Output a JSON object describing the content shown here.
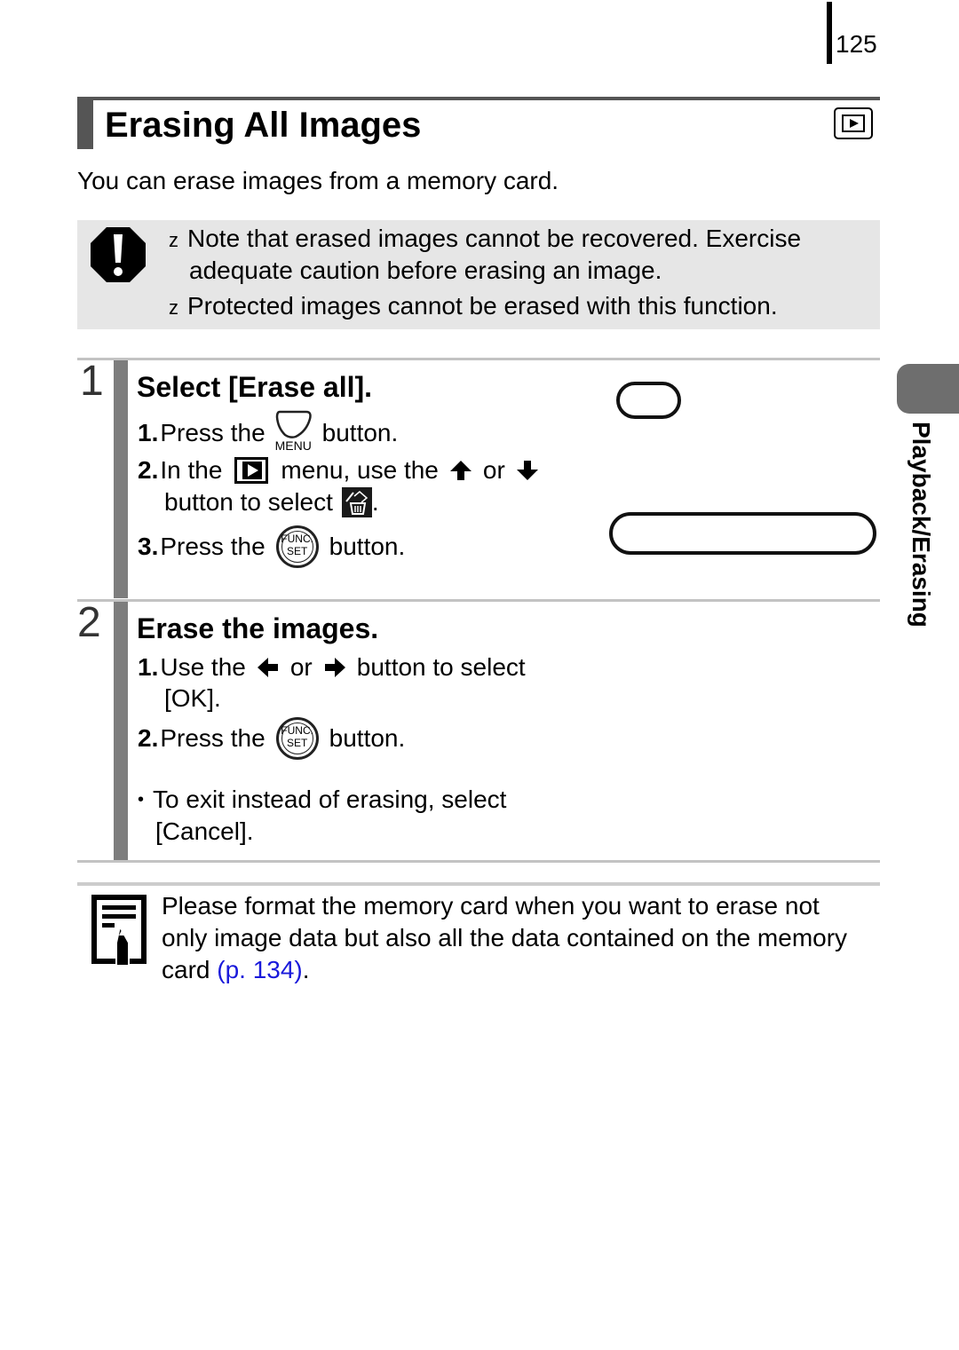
{
  "page": {
    "number": "125",
    "title": "Erasing All Images",
    "mode_icon": "playback-mode-icon",
    "intro": "You can erase images from a memory card."
  },
  "caution": {
    "icon": "caution-icon",
    "bullet_glyph": "z",
    "items": [
      {
        "lines": [
          "Note that erased images cannot be recovered. Exercise",
          "adequate caution before erasing an image."
        ]
      },
      {
        "lines": [
          "Protected images cannot be erased with this function."
        ]
      }
    ]
  },
  "steps": [
    {
      "number": "1",
      "heading": "Select [Erase all].",
      "substeps": [
        {
          "num": "1.",
          "pre": "Press the",
          "icon": "menu-button-icon",
          "icon_label": "MENU",
          "post": "button."
        },
        {
          "num": "2.",
          "pre": "In the",
          "icon": "playback-menu-icon",
          "mid": "menu, use the",
          "icon2": "up-arrow-icon",
          "or": "or",
          "icon3": "down-arrow-icon",
          "line2_pre": "button to select",
          "icon4": "erase-all-icon",
          "line2_post": "."
        },
        {
          "num": "3.",
          "pre": "Press the",
          "icon": "func-set-button-icon",
          "icon_label_top": "FUNC.",
          "icon_label_bottom": "SET",
          "post": "button."
        }
      ]
    },
    {
      "number": "2",
      "heading": "Erase the images.",
      "substeps": [
        {
          "num": "1.",
          "pre": "Use the",
          "icon": "left-arrow-icon",
          "or": "or",
          "icon2": "right-arrow-icon",
          "post": "button to select",
          "line2": "[OK]."
        },
        {
          "num": "2.",
          "pre": "Press the",
          "icon": "func-set-button-icon",
          "icon_label_top": "FUNC.",
          "icon_label_bottom": "SET",
          "post": "button."
        }
      ],
      "bullet": {
        "glyph": "•",
        "lines": [
          "To exit instead of erasing, select",
          "[Cancel]."
        ]
      }
    }
  ],
  "side_tab": {
    "label": "Playback/Erasing",
    "color": "#6e6e6e"
  },
  "note": {
    "icon": "memo-note-icon",
    "lines": [
      "Please format the memory card when you want to erase not",
      "only image data but also all the data contained on the memory",
      "card "
    ],
    "link_text": "(p. 134)",
    "trail": ".",
    "link_color": "#1a1adb"
  }
}
